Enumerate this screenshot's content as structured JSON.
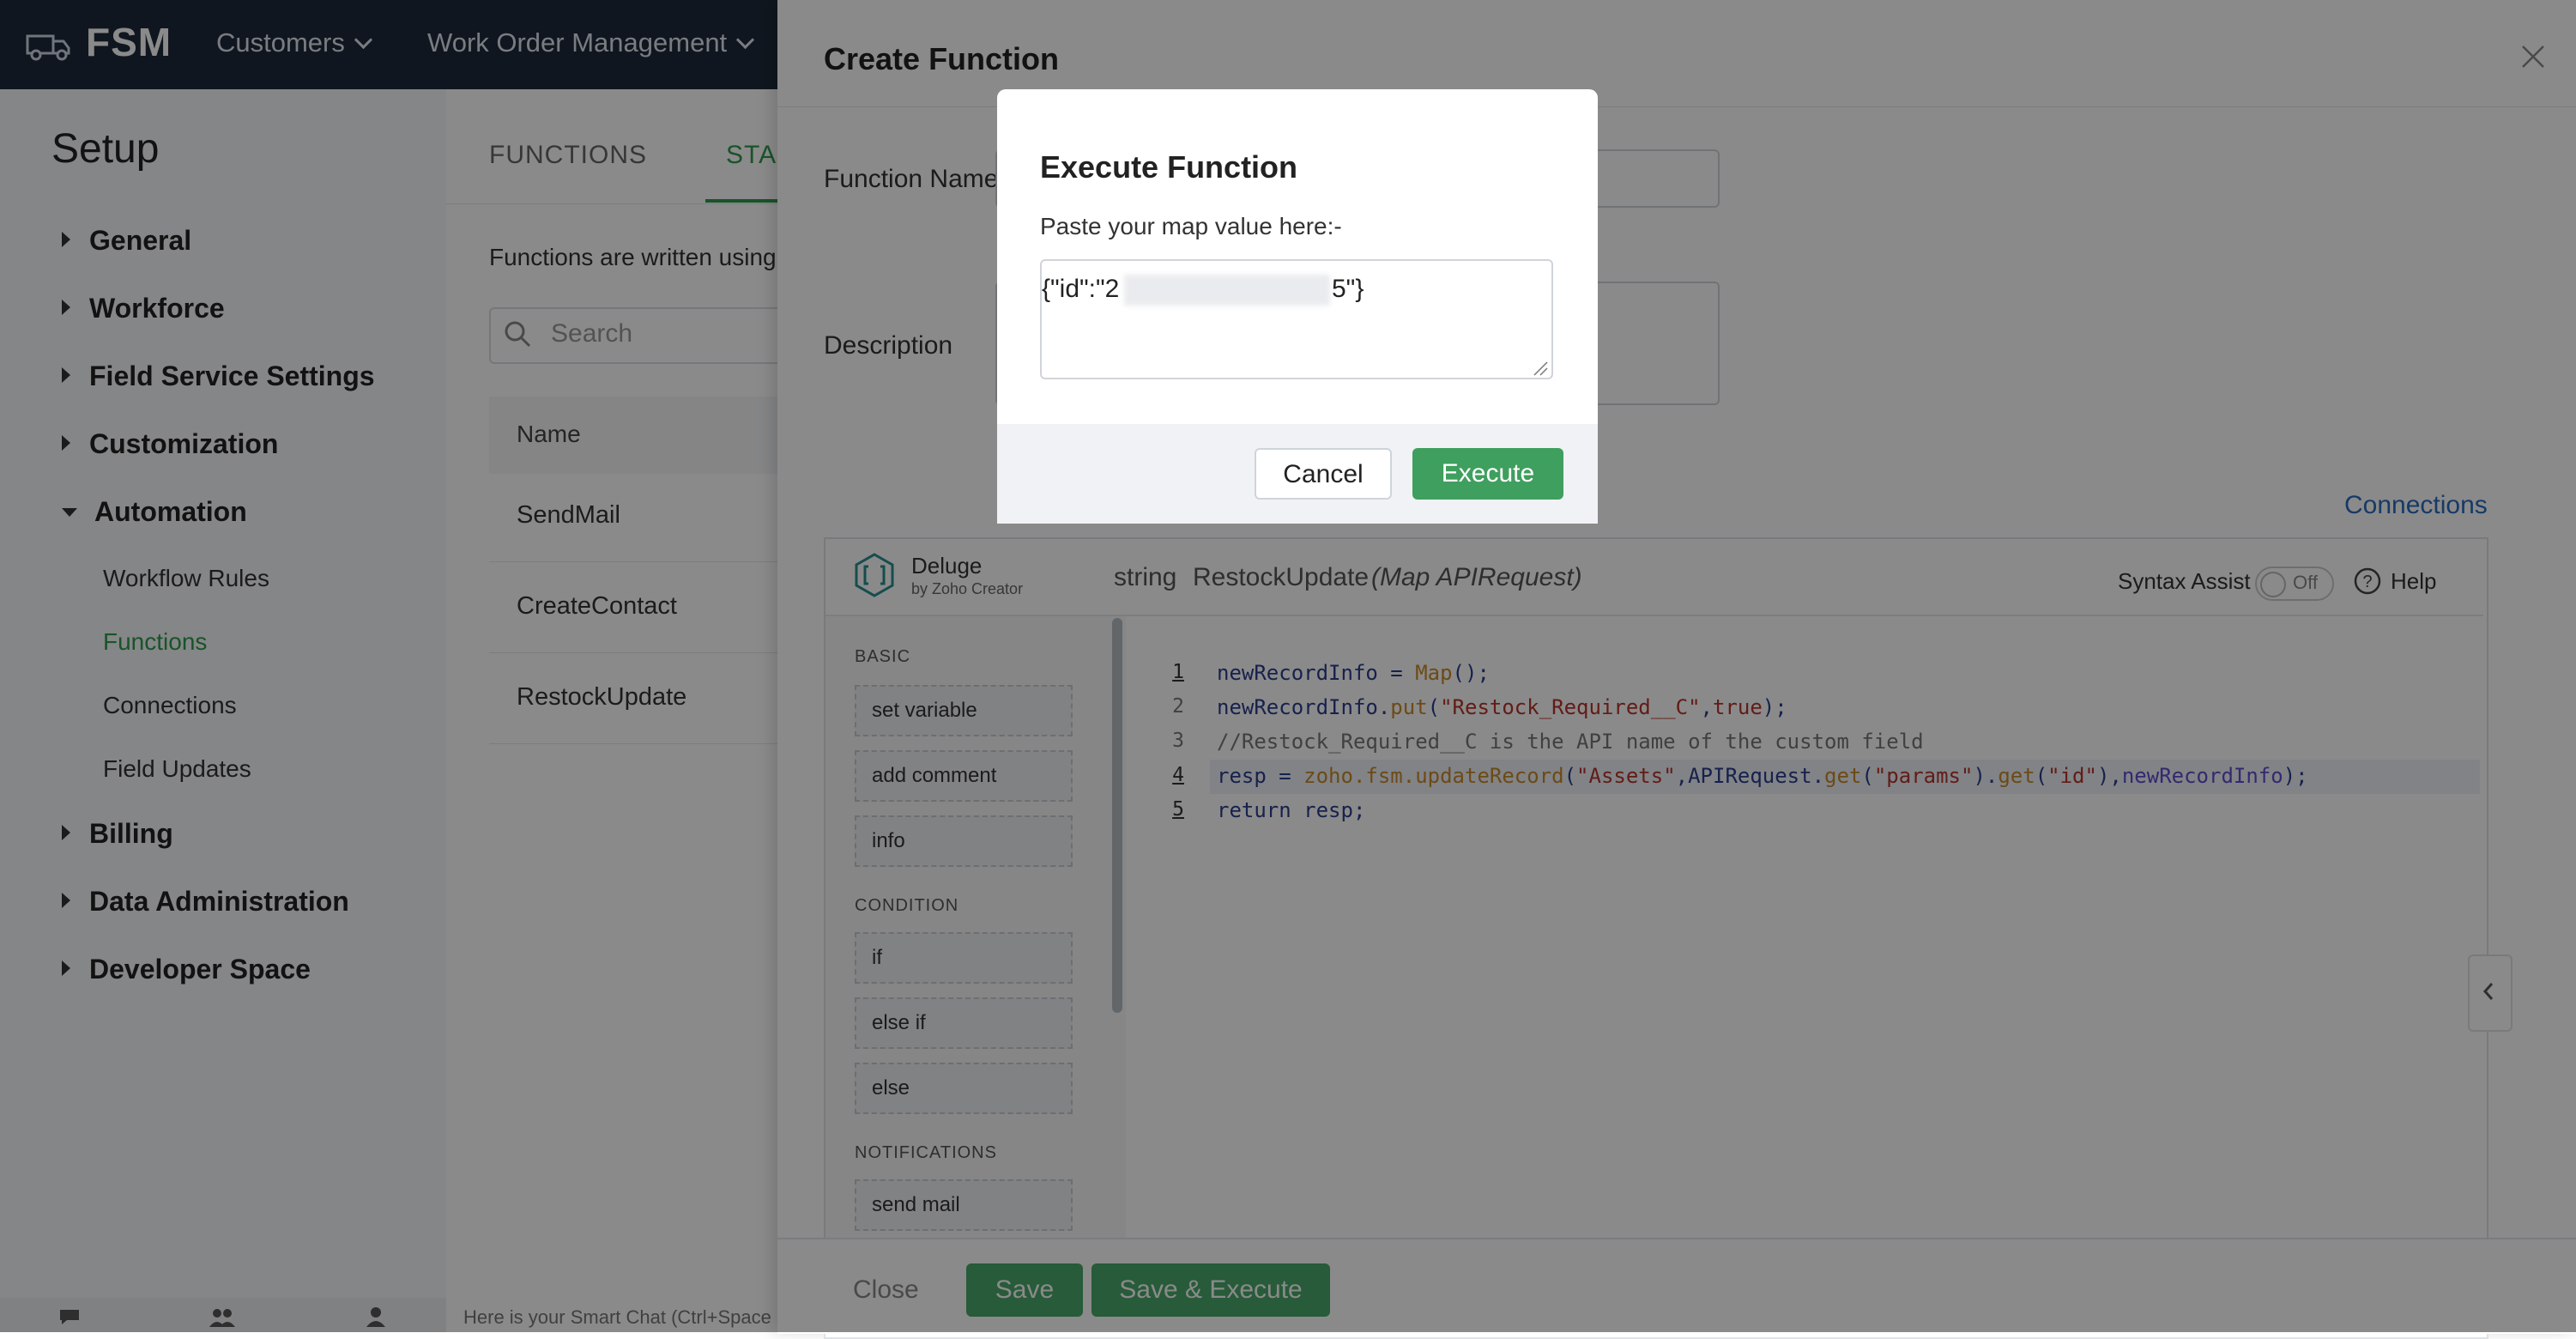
{
  "topbar": {
    "logo": "FSM",
    "nav": [
      {
        "label": "Customers"
      },
      {
        "label": "Work Order Management"
      }
    ]
  },
  "sidebar": {
    "title": "Setup",
    "groups": [
      {
        "label": "General"
      },
      {
        "label": "Workforce"
      },
      {
        "label": "Field Service Settings"
      },
      {
        "label": "Customization"
      },
      {
        "label": "Automation",
        "expanded": true
      },
      {
        "label": "Billing"
      },
      {
        "label": "Data Administration"
      },
      {
        "label": "Developer Space"
      }
    ],
    "automation_items": [
      {
        "label": "Workflow Rules"
      },
      {
        "label": "Functions",
        "active": true
      },
      {
        "label": "Connections"
      },
      {
        "label": "Field Updates"
      }
    ],
    "bottom_icons": [
      "chat-icon",
      "team-icon",
      "user-icon"
    ],
    "smart_chat": "Here is your Smart Chat (Ctrl+Space"
  },
  "functions_page": {
    "tabs": [
      {
        "label": "FUNCTIONS"
      },
      {
        "label": "STAN"
      }
    ],
    "description": "Functions are written using",
    "search_placeholder": "Search",
    "table_header": "Name",
    "rows": [
      "SendMail",
      "CreateContact",
      "RestockUpdate"
    ]
  },
  "panel": {
    "title": "Create Function",
    "function_name_label": "Function Name",
    "description_label": "Description",
    "connections_link": "Connections",
    "editor": {
      "lang_name": "Deluge",
      "lang_sub": "by Zoho Creator",
      "return_type": "string",
      "function_name": "RestockUpdate",
      "params": "(Map APIRequest)",
      "syntax_assist_label": "Syntax Assist",
      "syntax_assist_state": "Off",
      "help_label": "Help",
      "palette": {
        "basic_title": "BASIC",
        "basic": [
          "set variable",
          "add comment",
          "info"
        ],
        "condition_title": "CONDITION",
        "condition": [
          "if",
          "else if",
          "else"
        ],
        "notifications_title": "NOTIFICATIONS",
        "notifications": [
          "send mail"
        ]
      },
      "line_numbers": [
        "1",
        "2",
        "3",
        "4",
        "5"
      ]
    },
    "footer": {
      "close": "Close",
      "save": "Save",
      "save_execute": "Save & Execute"
    }
  },
  "modal": {
    "title": "Execute Function",
    "prompt": "Paste your map value here:-",
    "value_start": "{\"id\":\"2",
    "value_end": "5\"}",
    "cancel": "Cancel",
    "execute": "Execute"
  },
  "colors": {
    "topbar": "#1e2a3a",
    "accent_green": "#2e9b4d",
    "link_blue": "#2a6bbf",
    "execute_green": "#3f9f5e"
  }
}
